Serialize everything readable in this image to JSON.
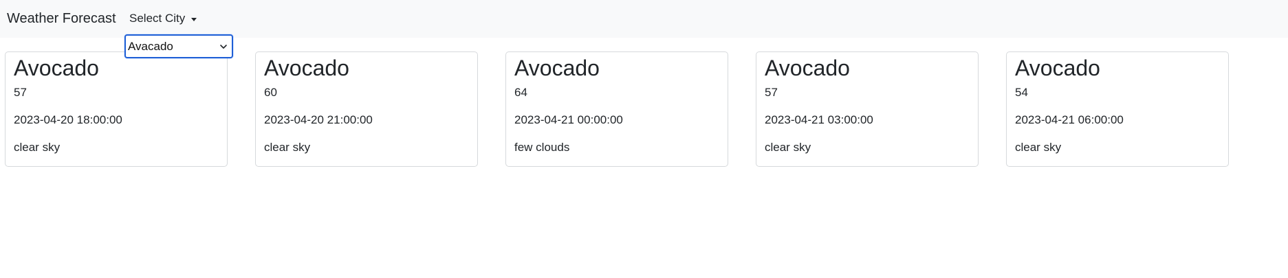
{
  "navbar": {
    "brand": "Weather Forecast",
    "dropdown_label": "Select City"
  },
  "city_select": {
    "value": "Avacado"
  },
  "forecasts": [
    {
      "city": "Avocado",
      "temp": "57",
      "datetime": "2023-04-20 18:00:00",
      "description": "clear sky"
    },
    {
      "city": "Avocado",
      "temp": "60",
      "datetime": "2023-04-20 21:00:00",
      "description": "clear sky"
    },
    {
      "city": "Avocado",
      "temp": "64",
      "datetime": "2023-04-21 00:00:00",
      "description": "few clouds"
    },
    {
      "city": "Avocado",
      "temp": "57",
      "datetime": "2023-04-21 03:00:00",
      "description": "clear sky"
    },
    {
      "city": "Avocado",
      "temp": "54",
      "datetime": "2023-04-21 06:00:00",
      "description": "clear sky"
    }
  ]
}
